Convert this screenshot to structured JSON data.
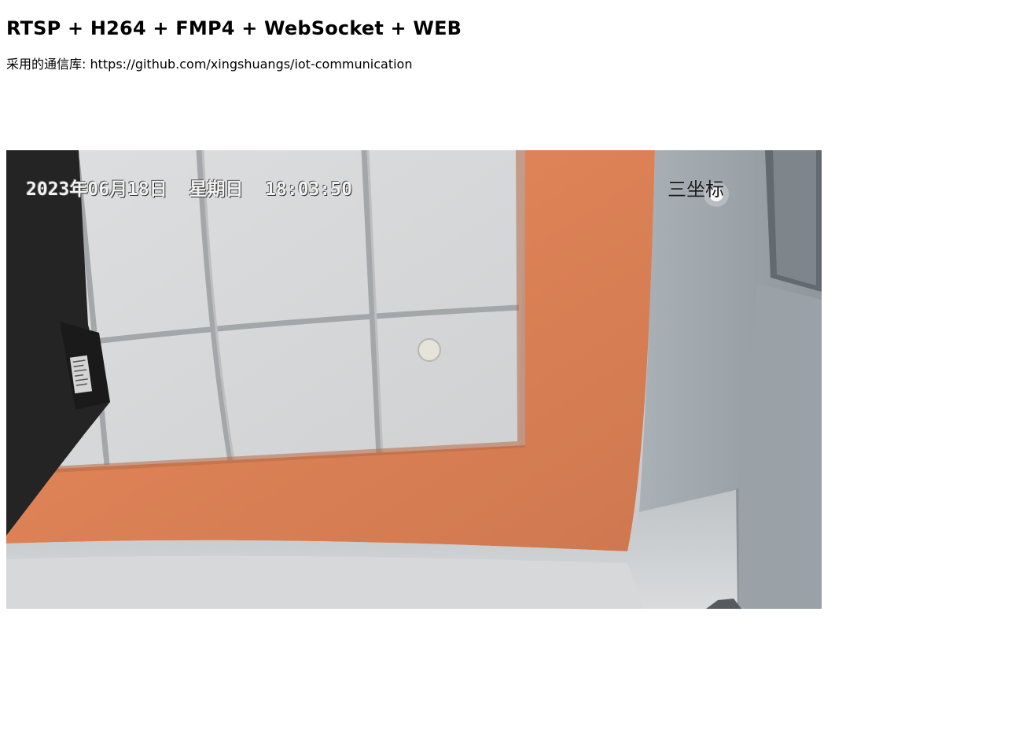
{
  "header": {
    "title": "RTSP + H264 + FMP4 + WebSocket + WEB",
    "library_text": "采用的通信库: https://github.com/xingshuangs/iot-communication"
  },
  "video": {
    "osd_timestamp": "2023年06月18日  星期日  18:03:50",
    "osd_label": "三坐标"
  }
}
